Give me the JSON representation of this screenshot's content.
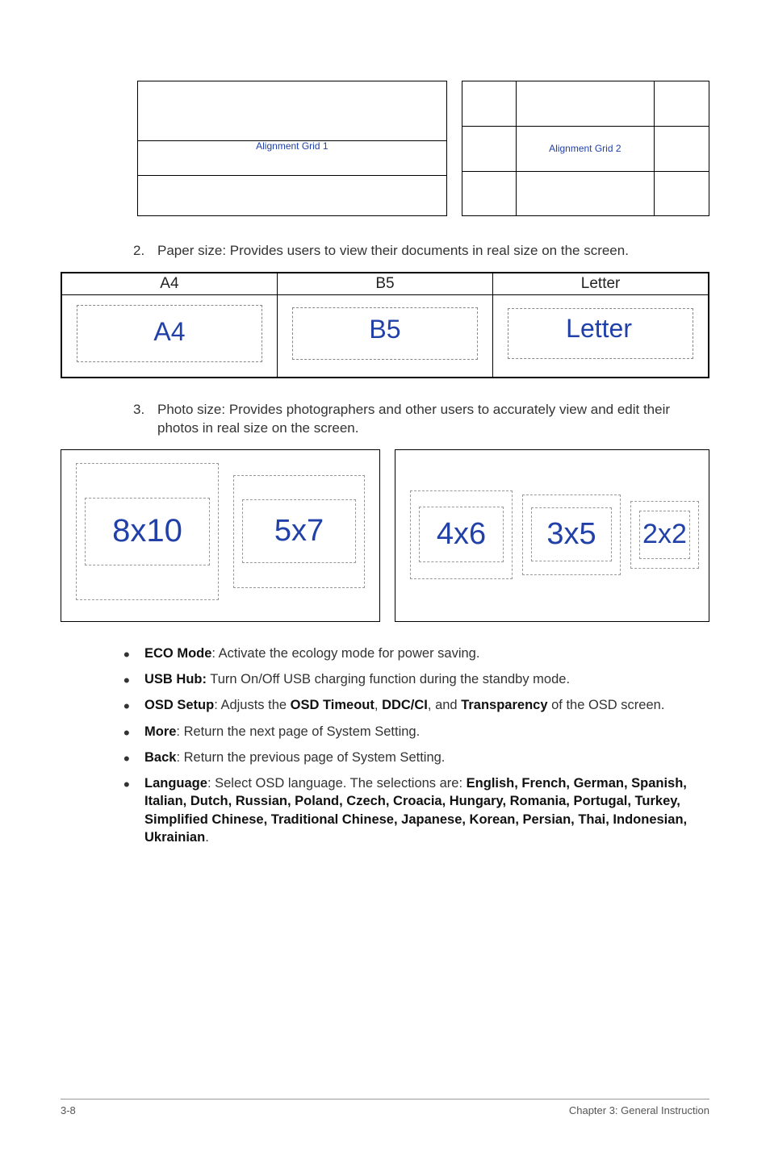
{
  "figure_alignment": {
    "grid1_label": "Alignment Grid 1",
    "grid2_label": "Alignment Grid 2"
  },
  "item2": {
    "number": "2.",
    "text": "Paper size: Provides users to view their documents in real size on the screen."
  },
  "paper_table": {
    "headers": [
      "A4",
      "B5",
      "Letter"
    ],
    "cells": [
      "A4",
      "B5",
      "Letter"
    ]
  },
  "item3": {
    "number": "3.",
    "text": "Photo size: Provides photographers and other users to accurately view and edit their photos in real size on the screen."
  },
  "photo_sizes": {
    "size1": "8x10",
    "size2": "5x7",
    "size3": "4x6",
    "size4": "3x5",
    "size5": "2x2"
  },
  "bullets": {
    "eco_b": "ECO Mode",
    "eco_t": ": Activate the ecology mode for power saving.",
    "usb_b": "USB Hub:",
    "usb_t": " Turn On/Off USB charging function during the standby mode.",
    "osd_b1": "OSD Setup",
    "osd_t1": ": Adjusts the ",
    "osd_b2": "OSD Timeout",
    "osd_t2": ", ",
    "osd_b3": "DDC/CI",
    "osd_t3": ", and ",
    "osd_b4": "Transparency",
    "osd_t4": " of the OSD screen.",
    "more_b": "More",
    "more_t": ": Return the next page of System Setting.",
    "back_b": "Back",
    "back_t": ": Return the previous page of System Setting.",
    "lang_b1": "Language",
    "lang_t1": ": Select OSD language. The selections are: ",
    "lang_b2": "English, French, German, Spanish, Italian, Dutch, Russian, Poland, Czech, Croacia, Hungary, Romania, Portugal, Turkey, Simplified Chinese, Traditional Chinese, Japanese, Korean, Persian, Thai, Indonesian, Ukrainian",
    "lang_t2": "."
  },
  "footer": {
    "left": "3-8",
    "right": "Chapter 3: General Instruction"
  }
}
